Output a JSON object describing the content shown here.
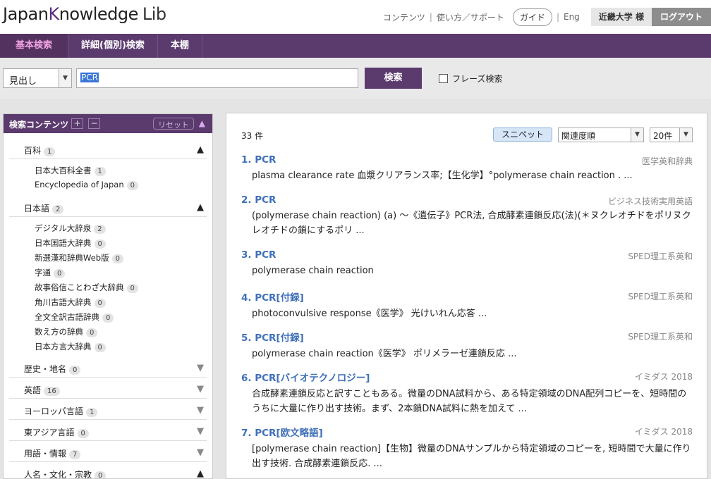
{
  "header": {
    "logo_main": "Japan",
    "logo_k": "K",
    "logo_rest": "nowledge",
    "logo_lib": "Lib",
    "link_contents": "コンテンツ",
    "link_usage": "使い方／サポート",
    "guide": "ガイド",
    "eng": "Eng",
    "user": "近畿大学 様",
    "logout": "ログアウト"
  },
  "nav": {
    "tabs": [
      "基本検索",
      "詳細(個別)検索",
      "本棚"
    ]
  },
  "search": {
    "field_select": "見出し",
    "query": "PCR",
    "button": "検索",
    "phrase_label": "フレーズ検索"
  },
  "sidebar": {
    "title": "検索コンテンツ",
    "plus": "+",
    "minus": "−",
    "reset": "リセット",
    "categories": [
      {
        "name": "百科",
        "count": "1",
        "items": [
          {
            "name": "日本大百科全書",
            "count": "1"
          },
          {
            "name": "Encyclopedia of Japan",
            "count": "0"
          }
        ]
      },
      {
        "name": "日本語",
        "count": "2",
        "items": [
          {
            "name": "デジタル大辞泉",
            "count": "2"
          },
          {
            "name": "日本国語大辞典",
            "count": "0"
          },
          {
            "name": "新選漢和辞典Web版",
            "count": "0"
          },
          {
            "name": "字通",
            "count": "0"
          },
          {
            "name": "故事俗信ことわざ大辞典",
            "count": "0"
          },
          {
            "name": "角川古語大辞典",
            "count": "0"
          },
          {
            "name": "全文全訳古語辞典",
            "count": "0"
          },
          {
            "name": "数え方の辞典",
            "count": "0"
          },
          {
            "name": "日本方言大辞典",
            "count": "0"
          }
        ]
      },
      {
        "name": "歴史・地名",
        "count": "0"
      },
      {
        "name": "英語",
        "count": "16"
      },
      {
        "name": "ヨーロッパ言語",
        "count": "1"
      },
      {
        "name": "東アジア言語",
        "count": "0"
      },
      {
        "name": "用語・情報",
        "count": "7"
      },
      {
        "name": "人名・文化・宗教",
        "count": "0"
      }
    ]
  },
  "results": {
    "count": "33 件",
    "snippet_btn": "スニペット",
    "sort": "関連度順",
    "per_page": "20件",
    "items": [
      {
        "title": "1. PCR",
        "source": "医学英和辞典",
        "snippet": "plasma clearance rate 血漿クリアランス率;【生化学】°polymerase chain reaction . ..."
      },
      {
        "title": "2. PCR",
        "source": "ビジネス技術実用英語",
        "snippet": "(polymerase chain reaction) (a) ～《遺伝子》PCR法, 合成酵素連鎖反応(法)(＊ヌクレオチドをポリヌクレオチドの鎖にするポリ ..."
      },
      {
        "title": "3. PCR",
        "source": "SPED理工系英和",
        "snippet": "polymerase chain reaction"
      },
      {
        "title": "4. PCR[付録]",
        "source": "SPED理工系英和",
        "snippet": "photoconvulsive response《医学》 光けいれん応答 ..."
      },
      {
        "title": "5. PCR[付録]",
        "source": "SPED理工系英和",
        "snippet": "polymerase chain reaction《医学》 ポリメラーゼ連鎖反応 ..."
      },
      {
        "title": "6. PCR[バイオテクノロジー]",
        "source": "イミダス 2018",
        "snippet": "合成酵素連鎖反応と訳すこともある。微量のDNA試料から、ある特定領域のDNA配列コピーを、短時間のうちに大量に作り出す技術。まず、2本鎖DNA試料に熱を加えて ..."
      },
      {
        "title": "7. PCR[欧文略語]",
        "source": "イミダス 2018",
        "snippet": "[polymerase chain reaction]【生物】微量のDNAサンプルから特定領域のコピーを, 短時間で大量に作り出す技術. 合成酵素連鎖反応. ..."
      }
    ]
  }
}
